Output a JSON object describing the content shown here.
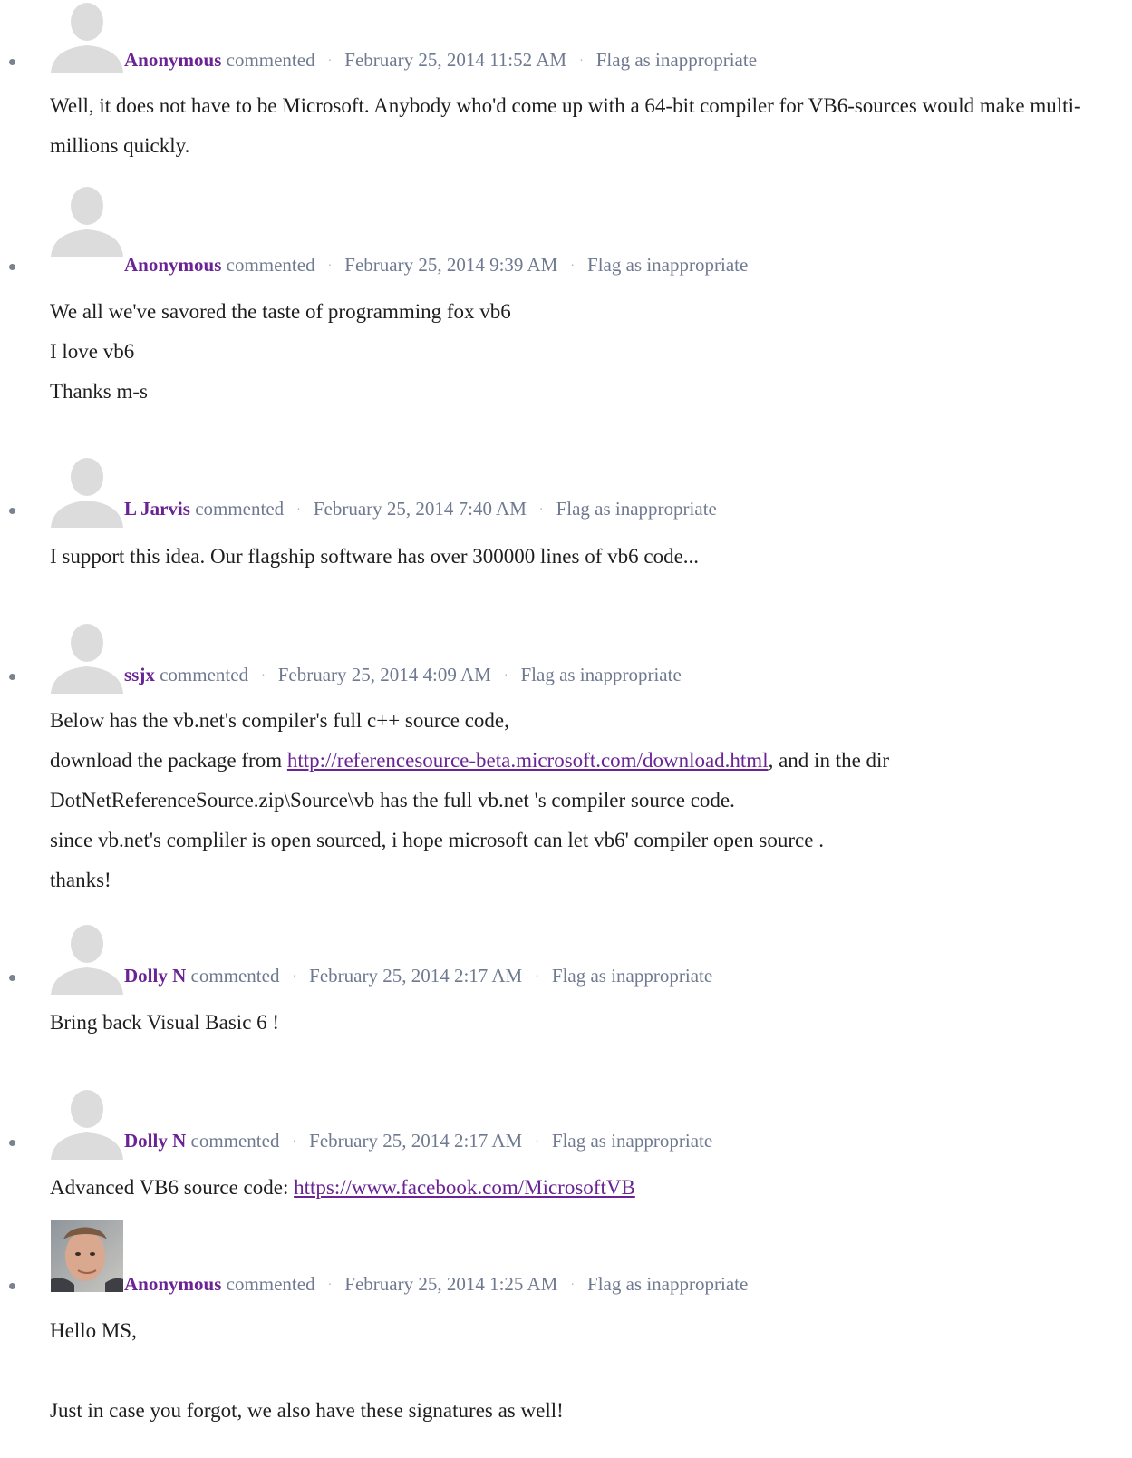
{
  "comments": [
    {
      "author": "Anonymous",
      "verb": "commented",
      "date": "February 25, 2014 11:52 AM",
      "flag": "Flag as inappropriate",
      "body": [
        "Well, it does not have to be Microsoft. Anybody who'd come up with a 64-bit compiler for VB6-sources would make multi-millions quickly."
      ]
    },
    {
      "author": "Anonymous",
      "verb": "commented",
      "date": "February 25, 2014 9:39 AM",
      "flag": "Flag as inappropriate",
      "body": [
        "We all we've savored the taste of programming fox vb6",
        "I love vb6",
        "Thanks m-s"
      ]
    },
    {
      "author": "L Jarvis",
      "verb": "commented",
      "date": "February 25, 2014 7:40 AM",
      "flag": "Flag as inappropriate",
      "body": [
        "I support this idea. Our flagship software has over 300000 lines of vb6 code..."
      ]
    },
    {
      "author": "ssjx",
      "verb": "commented",
      "date": "February 25, 2014 4:09 AM",
      "flag": "Flag as inappropriate",
      "body": [
        "Below has the vb.net's compiler's full c++ source code,",
        {
          "before": "download the package from ",
          "link": "http://referencesource-beta.microsoft.com/download.html",
          "after": ", and in the dir"
        },
        "DotNetReferenceSource.zip\\Source\\vb has the full vb.net 's compiler source code.",
        "since vb.net's compliler is open sourced, i hope microsoft can let vb6' compiler open source .",
        "thanks!"
      ]
    },
    {
      "author": "Dolly N",
      "verb": "commented",
      "date": "February 25, 2014 2:17 AM",
      "flag": "Flag as inappropriate",
      "body": [
        "Bring back Visual Basic 6 !"
      ]
    },
    {
      "author": "Dolly N",
      "verb": "commented",
      "date": "February 25, 2014 2:17 AM",
      "flag": "Flag as inappropriate",
      "body": [
        {
          "before": "Advanced VB6 source code: ",
          "link": "https://www.facebook.com/MicrosoftVB",
          "after": ""
        }
      ]
    },
    {
      "author": "Anonymous",
      "verb": "commented",
      "date": "February 25, 2014 1:25 AM",
      "flag": "Flag as inappropriate",
      "photo": true,
      "body": [
        "Hello MS,",
        "",
        "Just in case you forgot, we also have these signatures as well!"
      ]
    }
  ],
  "colors": {
    "author": "#6a2394",
    "meta": "#6f7a91",
    "body_text": "#1e1e1e",
    "avatar_placeholder": "#dcdcdc"
  },
  "icons": {
    "avatar_placeholder": "user-silhouette-icon",
    "avatar_photo": "user-photo-icon"
  }
}
